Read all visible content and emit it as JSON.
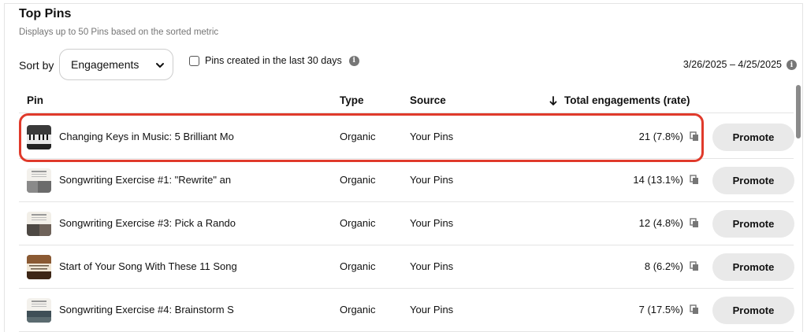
{
  "header": {
    "title": "Top Pins",
    "subtitle": "Displays up to 50 Pins based on the sorted metric"
  },
  "controls": {
    "sort_label": "Sort by",
    "sort_value": "Engagements",
    "checkbox_label": "Pins created in the last 30 days",
    "checkbox_checked": false,
    "date_range": "3/26/2025 – 4/25/2025",
    "info_glyph": "i"
  },
  "table": {
    "columns": {
      "pin": "Pin",
      "type": "Type",
      "source": "Source",
      "engagements": "Total engagements (rate)"
    },
    "sort_direction": "descending",
    "rows": [
      {
        "title": "Changing Keys in Music: 5 Brilliant Mo",
        "type": "Organic",
        "source": "Your Pins",
        "engagements": "21 (7.8%)",
        "action": "Promote",
        "thumb": "piano"
      },
      {
        "title": "Songwriting Exercise #1: \"Rewrite\" an",
        "type": "Organic",
        "source": "Your Pins",
        "engagements": "14 (13.1%)",
        "action": "Promote",
        "thumb": "notes"
      },
      {
        "title": "Songwriting Exercise #3: Pick a Rando",
        "type": "Organic",
        "source": "Your Pins",
        "engagements": "12 (4.8%)",
        "action": "Promote",
        "thumb": "notes-dark"
      },
      {
        "title": "Start of Your Song With These 11 Song",
        "type": "Organic",
        "source": "Your Pins",
        "engagements": "8 (6.2%)",
        "action": "Promote",
        "thumb": "guitar"
      },
      {
        "title": "Songwriting Exercise #4: Brainstorm S",
        "type": "Organic",
        "source": "Your Pins",
        "engagements": "7 (17.5%)",
        "action": "Promote",
        "thumb": "notes-teal"
      }
    ]
  },
  "colors": {
    "highlight": "#e03a2b",
    "button_bg": "#e9e9e9",
    "muted_text": "#767676"
  }
}
